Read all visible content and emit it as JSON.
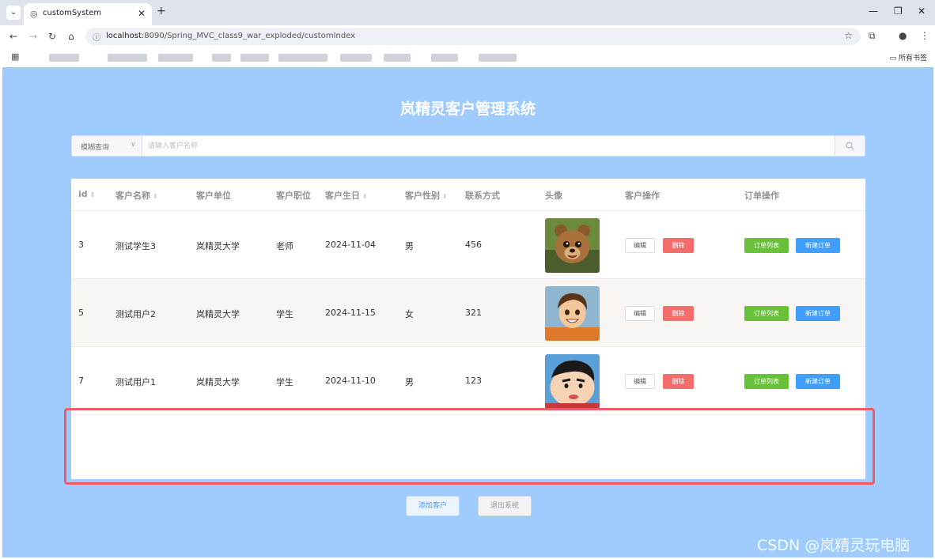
{
  "browser": {
    "tab_title": "customSystem",
    "url_host": "localhost",
    "url_rest": ":8090/Spring_MVC_class9_war_exploded/customIndex",
    "all_bookmarks": "所有书签"
  },
  "page": {
    "title": "岚精灵客户管理系统",
    "search": {
      "select_value": "模糊查询",
      "placeholder": "请输入客户名称"
    },
    "table": {
      "headers": {
        "id": "id",
        "name": "客户名称",
        "company": "客户单位",
        "position": "客户职位",
        "birthday": "客户生日",
        "gender": "客户性别",
        "contact": "联系方式",
        "avatar": "头像",
        "customer_ops": "客户操作",
        "order_ops": "订单操作"
      },
      "rows": [
        {
          "id": "3",
          "name": "测试学生3",
          "company": "岚精灵大学",
          "position": "老师",
          "birthday": "2024-11-04",
          "gender": "男",
          "contact": "456",
          "avatar": "bear-avatar"
        },
        {
          "id": "5",
          "name": "测试用户2",
          "company": "岚精灵大学",
          "position": "学生",
          "birthday": "2024-11-15",
          "gender": "女",
          "contact": "321",
          "avatar": "boy-avatar"
        },
        {
          "id": "7",
          "name": "测试用户1",
          "company": "岚精灵大学",
          "position": "学生",
          "birthday": "2024-11-10",
          "gender": "男",
          "contact": "123",
          "avatar": "cartoon-avatar"
        }
      ],
      "actions": {
        "edit": "编辑",
        "delete": "删除",
        "order_list": "订单列表",
        "new_order": "新建订单"
      }
    },
    "add_button": "添加客户",
    "exit_button": "退出系统",
    "watermark": "CSDN @岚精灵玩电脑"
  },
  "colors": {
    "page_bg": "#9fccfd",
    "highlight": "#f05a6a",
    "danger": "#f56c6c",
    "success": "#67c23a",
    "primary": "#409eff"
  }
}
